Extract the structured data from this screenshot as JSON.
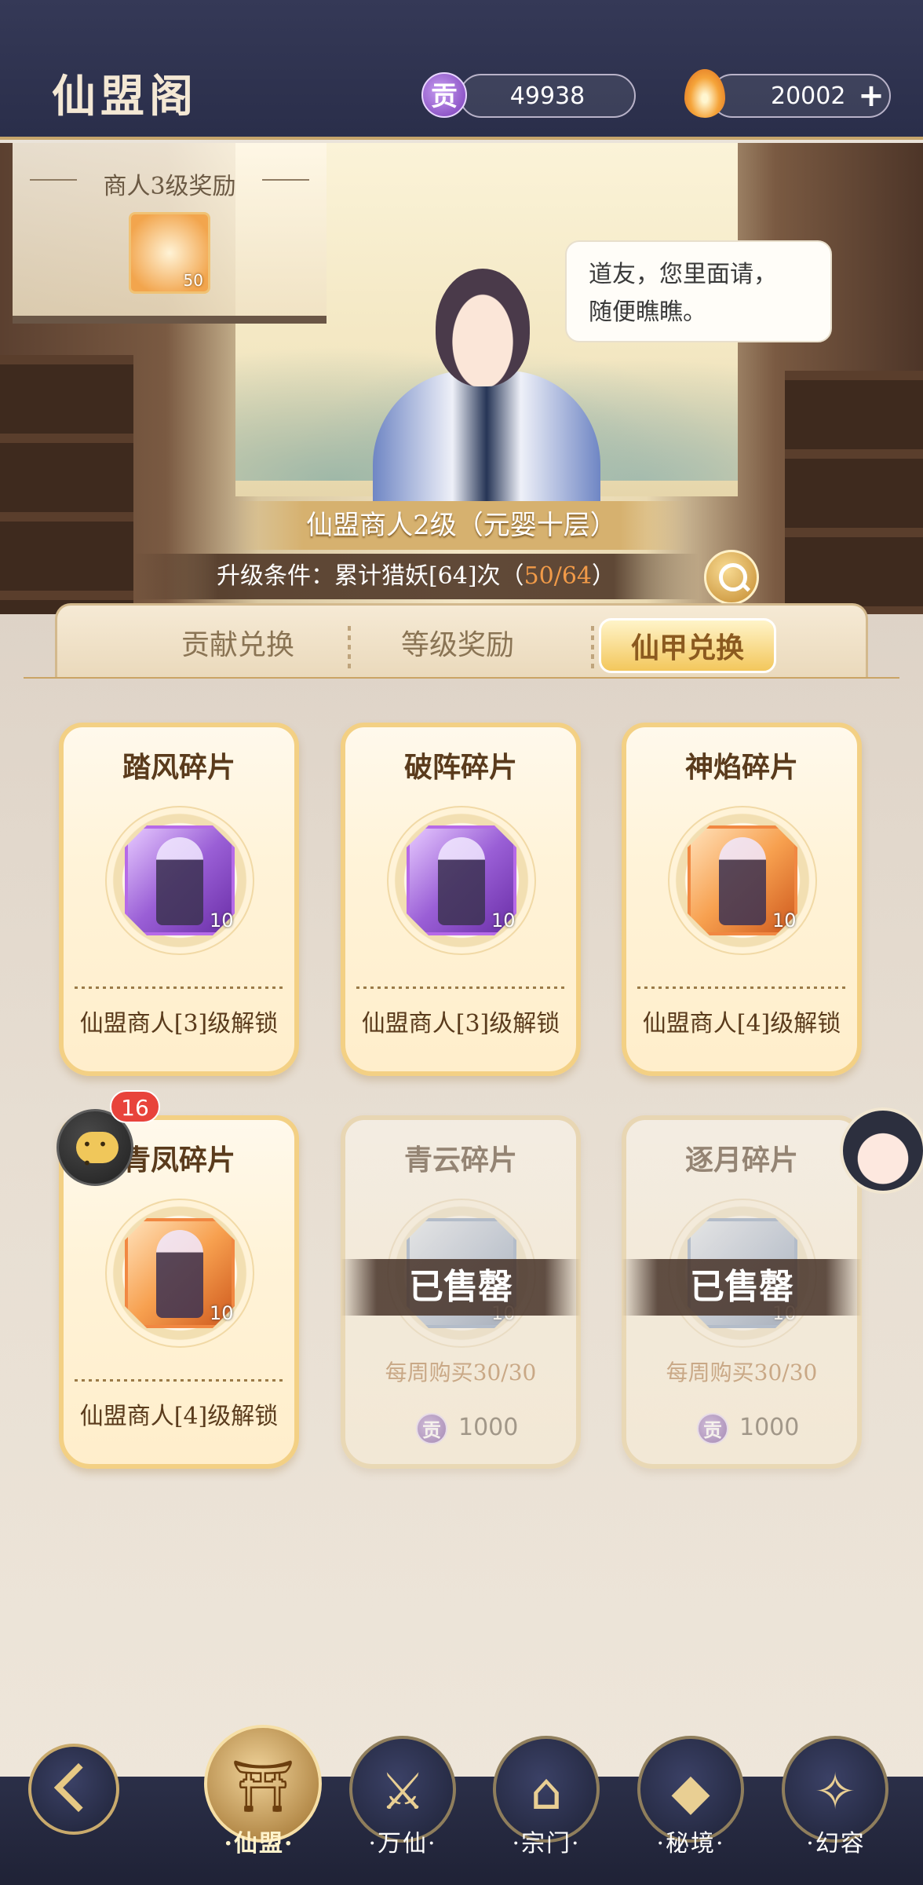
{
  "header": {
    "title": "仙盟阁",
    "contribution": {
      "icon": "gong-currency-icon",
      "value": "49938"
    },
    "spirit": {
      "icon": "flame-currency-icon",
      "value": "20002"
    },
    "add_label": "+"
  },
  "scene": {
    "reward": {
      "title": "商人3级奖励",
      "item_icon": "flame-item-icon",
      "count": "50"
    },
    "dialogue": {
      "line1": "道友，您里面请，",
      "line2": "随便瞧瞧。"
    },
    "level": {
      "title": "仙盟商人2级（元婴十层）"
    },
    "upgrade": {
      "prefix": "升级条件：累计猎妖[64]次（",
      "progress": "50/64",
      "suffix": "）"
    }
  },
  "tabs": [
    {
      "label": "贡献兑换",
      "active": false
    },
    {
      "label": "等级奖励",
      "active": false
    },
    {
      "label": "仙甲兑换",
      "active": true
    }
  ],
  "cards": [
    {
      "name": "踏风碎片",
      "qty": "10",
      "lock": "仙盟商人[3]级解锁"
    },
    {
      "name": "破阵碎片",
      "qty": "10",
      "lock": "仙盟商人[3]级解锁"
    },
    {
      "name": "神焰碎片",
      "qty": "10",
      "lock": "仙盟商人[4]级解锁"
    },
    {
      "name": "青凤碎片",
      "qty": "10",
      "lock": "仙盟商人[4]级解锁"
    },
    {
      "name": "青云碎片",
      "qty": "10",
      "soldout": "已售罄",
      "limit": "每周购买30/30",
      "price": "1000"
    },
    {
      "name": "逐月碎片",
      "qty": "10",
      "soldout": "已售罄",
      "limit": "每周购买30/30",
      "price": "1000"
    }
  ],
  "chat": {
    "badge": "16"
  },
  "nav": {
    "back_icon": "back-arrow-icon",
    "items": [
      {
        "label": "·仙盟·",
        "active": true
      },
      {
        "label": "·万仙·",
        "active": false
      },
      {
        "label": "·宗门·",
        "active": false
      },
      {
        "label": "·秘境·",
        "active": false
      },
      {
        "label": "·幻容",
        "active": false
      }
    ]
  },
  "colors": {
    "gold": "#f3d084",
    "dark_bar": "#2a2e4a",
    "progress": "#f19a48"
  }
}
